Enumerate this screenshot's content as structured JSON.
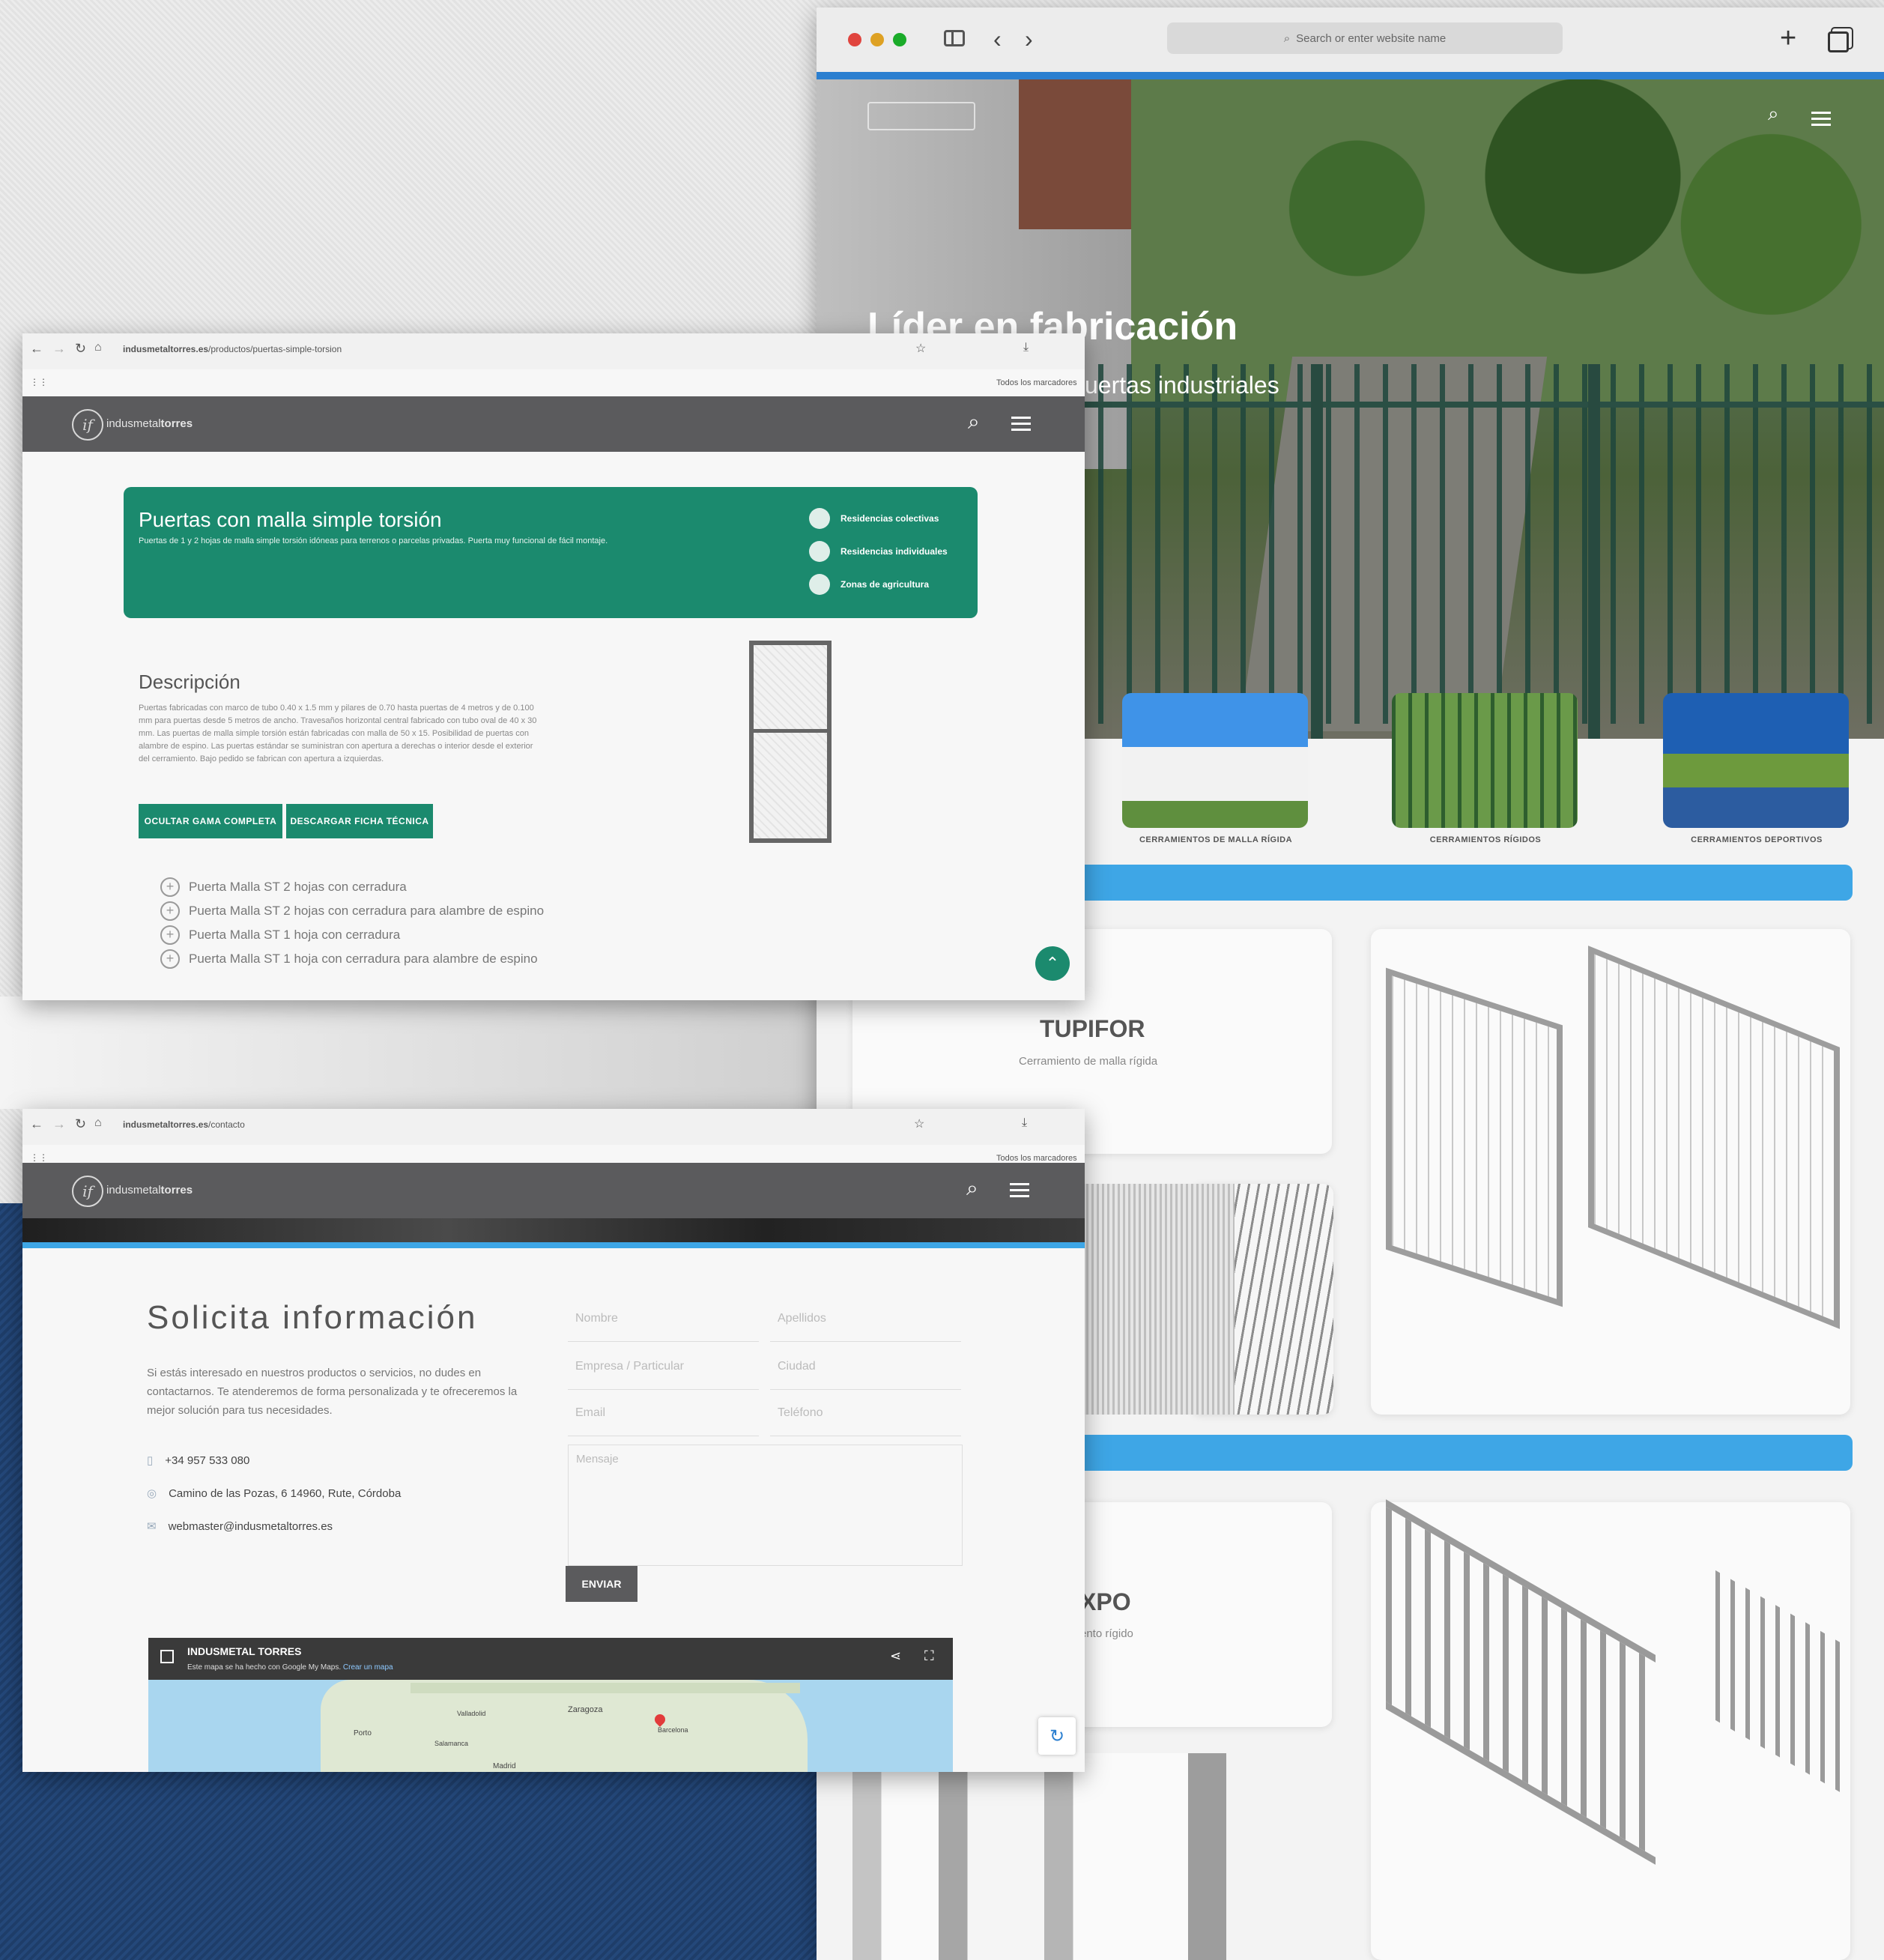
{
  "hero_window": {
    "address_placeholder": "Search or enter website name",
    "hero_title": "Líder en fabricación",
    "hero_subtitle": "uertas industriales",
    "categories": [
      {
        "label": "CERRAMIENTOS DE MALLA RÍGIDA"
      },
      {
        "label": "CERRAMIENTOS RÍGIDOS"
      },
      {
        "label": "CERRAMIENTOS DEPORTIVOS"
      }
    ],
    "product1_name": "TUPIFOR",
    "product1_desc": "Cerramiento de malla rígida",
    "product2_name": "XPO",
    "product2_desc": "ento rígido",
    "accent_blue": "#3ea6e6"
  },
  "product_window": {
    "url_domain": "indusmetaltorres.es",
    "url_path": "/productos/puertas-simple-torsion",
    "bookmarks_label": "Todos los marcadores",
    "brand_light": "indusmetal",
    "brand_bold": "torres",
    "banner_title": "Puertas con malla simple torsión",
    "banner_subtitle": "Puertas de 1 y 2 hojas de malla simple torsión idóneas para terrenos o parcelas privadas. Puerta muy funcional de fácil montaje.",
    "uses": [
      {
        "label": "Residencias colectivas"
      },
      {
        "label": "Residencias individuales"
      },
      {
        "label": "Zonas de agricultura"
      }
    ],
    "description_heading": "Descripción",
    "description_text": "Puertas fabricadas con marco de tubo 0.40 x 1.5 mm y pilares de 0.70 hasta puertas de 4 metros y de 0.100 mm para puertas desde 5 metros de ancho. Travesaños horizontal central fabricado con tubo oval de 40 x 30 mm. Las puertas de malla simple torsión están fabricadas con malla de 50 x 15. Posibilidad de puertas con alambre de espino. Las puertas estándar se suministran con apertura a derechas o interior desde el exterior del cerramiento. Bajo pedido se fabrican con apertura a izquierdas.",
    "btn_hide_range": "OCULTAR GAMA COMPLETA",
    "btn_download_sheet": "DESCARGAR FICHA TÉCNICA",
    "variants": [
      {
        "label": "Puerta Malla ST 2 hojas con cerradura"
      },
      {
        "label": "Puerta Malla ST 2 hojas con cerradura para alambre de espino"
      },
      {
        "label": "Puerta Malla ST 1 hoja con cerradura"
      },
      {
        "label": "Puerta Malla ST 1 hoja con cerradura para alambre de espino"
      }
    ],
    "brand_teal": "#1b8a6e",
    "nav_gray": "#5b5b5d"
  },
  "contact_window": {
    "url_domain": "indusmetaltorres.es",
    "url_path": "/contacto",
    "bookmarks_label": "Todos los marcadores",
    "brand_light": "indusmetal",
    "brand_bold": "torres",
    "heading": "Solicita información",
    "intro_text": "Si estás interesado en nuestros productos o servicios, no dudes en contactarnos. Te atenderemos de forma personalizada y te ofreceremos la mejor solución para tus necesidades.",
    "phone": "+34 957 533 080",
    "address": "Camino de las Pozas, 6 14960, Rute, Córdoba",
    "email": "webmaster@indusmetaltorres.es",
    "form": {
      "nombre": "Nombre",
      "apellidos": "Apellidos",
      "empresa": "Empresa / Particular",
      "ciudad": "Ciudad",
      "email": "Email",
      "telefono": "Teléfono",
      "mensaje": "Mensaje"
    },
    "submit_label": "ENVIAR",
    "map_title": "INDUSMETAL TORRES",
    "map_subtitle": "Este mapa se ha hecho con Google My Maps.",
    "map_link": "Crear un mapa",
    "map_places": [
      {
        "label": "Zaragoza"
      },
      {
        "label": "Barcelona"
      },
      {
        "label": "Valladolid"
      },
      {
        "label": "Salamanca"
      },
      {
        "label": "Porto"
      },
      {
        "label": "Madrid"
      }
    ]
  }
}
